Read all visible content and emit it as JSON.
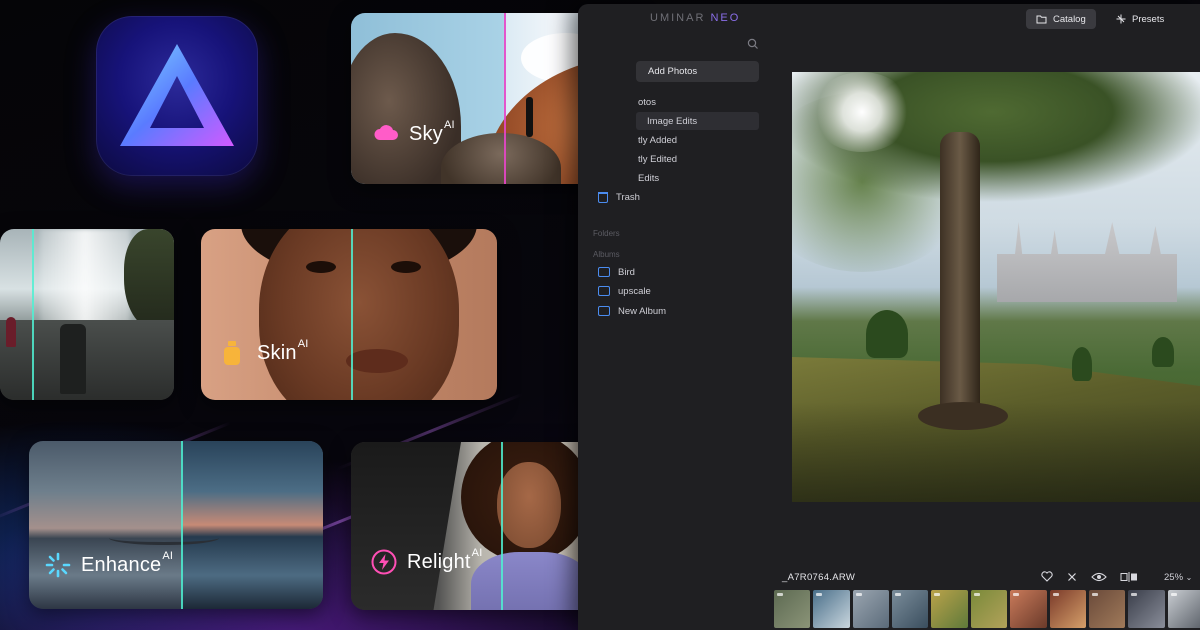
{
  "features": {
    "sky": {
      "label": "Sky",
      "badge": "AI"
    },
    "skin": {
      "label": "Skin",
      "badge": "AI"
    },
    "enhance": {
      "label": "Enhance",
      "badge": "AI"
    },
    "relight": {
      "label": "Relight",
      "badge": "AI"
    }
  },
  "app": {
    "brand": "UMINAR",
    "brand_suffix": "NEO",
    "topbar": {
      "catalog": "Catalog",
      "presets": "Presets"
    },
    "sidebar": {
      "add_photos": "Add Photos",
      "items": [
        "otos",
        "Image Edits",
        "tly Added",
        "tly Edited",
        "Edits"
      ],
      "trash": "Trash",
      "folders_label": "Folders",
      "albums_label": "Albums",
      "albums": [
        "Bird",
        "upscale",
        "New Album"
      ]
    },
    "viewer": {
      "filename": "_A7R0764.ARW",
      "zoom": "25%"
    }
  },
  "colors": {
    "accent": "#4b8cf0",
    "split_teal": "#50f0d2",
    "split_pink": "#e646c8",
    "window_bg": "#1f1f22"
  },
  "icons": {
    "sky": "cloud-icon",
    "skin": "bottle-icon",
    "enhance": "sparkle-icon",
    "relight": "bolt-icon"
  }
}
